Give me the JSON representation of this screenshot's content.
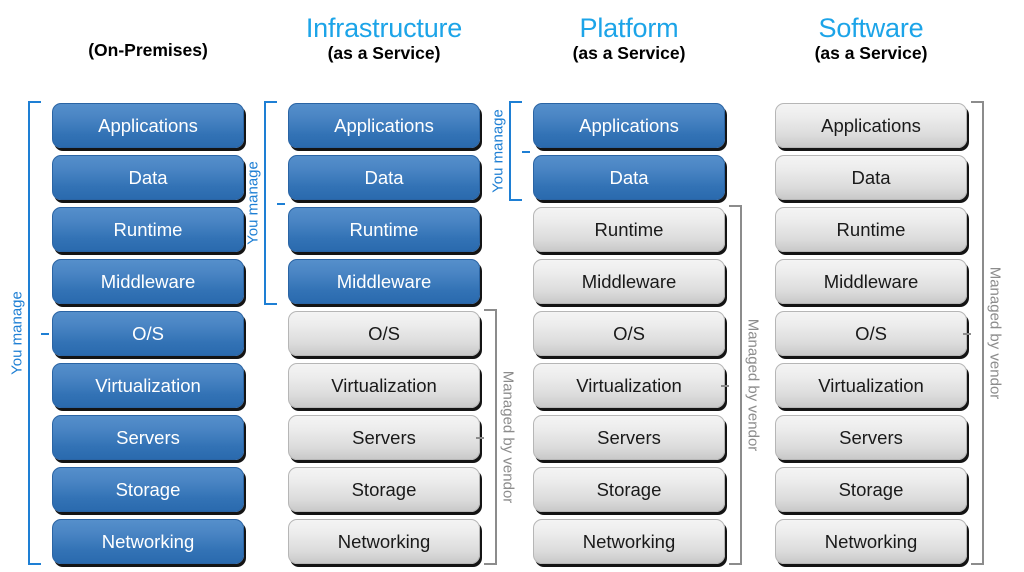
{
  "diagram": {
    "layers": [
      "Applications",
      "Data",
      "Runtime",
      "Middleware",
      "O/S",
      "Virtualization",
      "Servers",
      "Storage",
      "Networking"
    ],
    "colors": {
      "title_blue": "#1CA4E8",
      "bracket_blue": "#1E7FD4",
      "bracket_gray": "#8C8C8C",
      "box_blue": "#3272B5",
      "box_gray": "#DCDCDC",
      "text_black": "#000000"
    },
    "columns": [
      {
        "id": "on-premises",
        "title": "",
        "subtitle": "(On-Premises)",
        "managed_by_you": [
          "Applications",
          "Data",
          "Runtime",
          "Middleware",
          "O/S",
          "Virtualization",
          "Servers",
          "Storage",
          "Networking"
        ],
        "managed_by_vendor": [],
        "you_manage_label": "You manage",
        "vendor_label": ""
      },
      {
        "id": "iaas",
        "title": "Infrastructure",
        "subtitle": "(as a Service)",
        "managed_by_you": [
          "Applications",
          "Data",
          "Runtime",
          "Middleware"
        ],
        "managed_by_vendor": [
          "O/S",
          "Virtualization",
          "Servers",
          "Storage",
          "Networking"
        ],
        "you_manage_label": "You manage",
        "vendor_label": "Managed by vendor"
      },
      {
        "id": "paas",
        "title": "Platform",
        "subtitle": "(as a Service)",
        "managed_by_you": [
          "Applications",
          "Data"
        ],
        "managed_by_vendor": [
          "Runtime",
          "Middleware",
          "O/S",
          "Virtualization",
          "Servers",
          "Storage",
          "Networking"
        ],
        "you_manage_label": "You manage",
        "vendor_label": "Managed by vendor"
      },
      {
        "id": "saas",
        "title": "Software",
        "subtitle": "(as a Service)",
        "managed_by_you": [],
        "managed_by_vendor": [
          "Applications",
          "Data",
          "Runtime",
          "Middleware",
          "O/S",
          "Virtualization",
          "Servers",
          "Storage",
          "Networking"
        ],
        "you_manage_label": "",
        "vendor_label": "Managed by vendor"
      }
    ]
  }
}
